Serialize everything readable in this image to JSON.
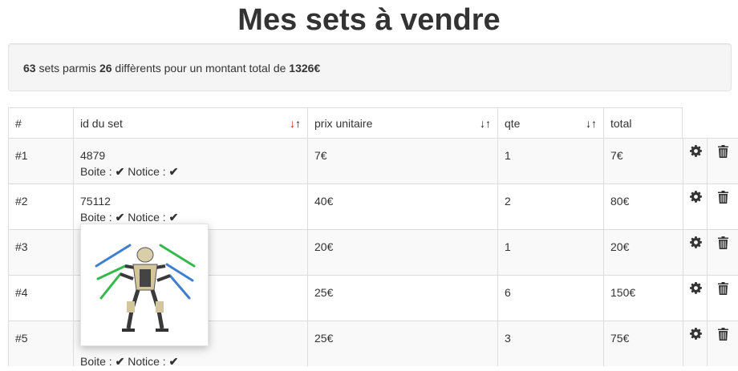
{
  "page_title": "Mes sets à vendre",
  "summary": {
    "count": "63",
    "text1": " sets parmis ",
    "distinct": "26",
    "text2": " diffèrents pour un montant total de ",
    "total": "1326€"
  },
  "table": {
    "headers": {
      "index": "#",
      "set_id": "id du set",
      "unit_price": "prix unitaire",
      "qty": "qte",
      "total": "total"
    },
    "sort_icons": {
      "down": "↓",
      "up": "↑"
    },
    "boite_label": "Boite : ",
    "notice_label": " Notice : ",
    "check": "✔",
    "rows": [
      {
        "index": "#1",
        "set_id": "4879",
        "price": "7€",
        "qty": "1",
        "total": "7€"
      },
      {
        "index": "#2",
        "set_id": "75112",
        "price": "40€",
        "qty": "2",
        "total": "80€"
      },
      {
        "index": "#3",
        "set_id": "",
        "price": "20€",
        "qty": "1",
        "total": "20€"
      },
      {
        "index": "#4",
        "set_id": "",
        "price": "25€",
        "qty": "6",
        "total": "150€"
      },
      {
        "index": "#5",
        "set_id": "",
        "price": "25€",
        "qty": "3",
        "total": "75€"
      }
    ]
  },
  "icons": {
    "settings": "gear-icon",
    "delete": "trash-icon"
  },
  "colors": {
    "sort_active": "#e0141b",
    "stripe": "#f9f9f9",
    "border": "#dddddd"
  }
}
